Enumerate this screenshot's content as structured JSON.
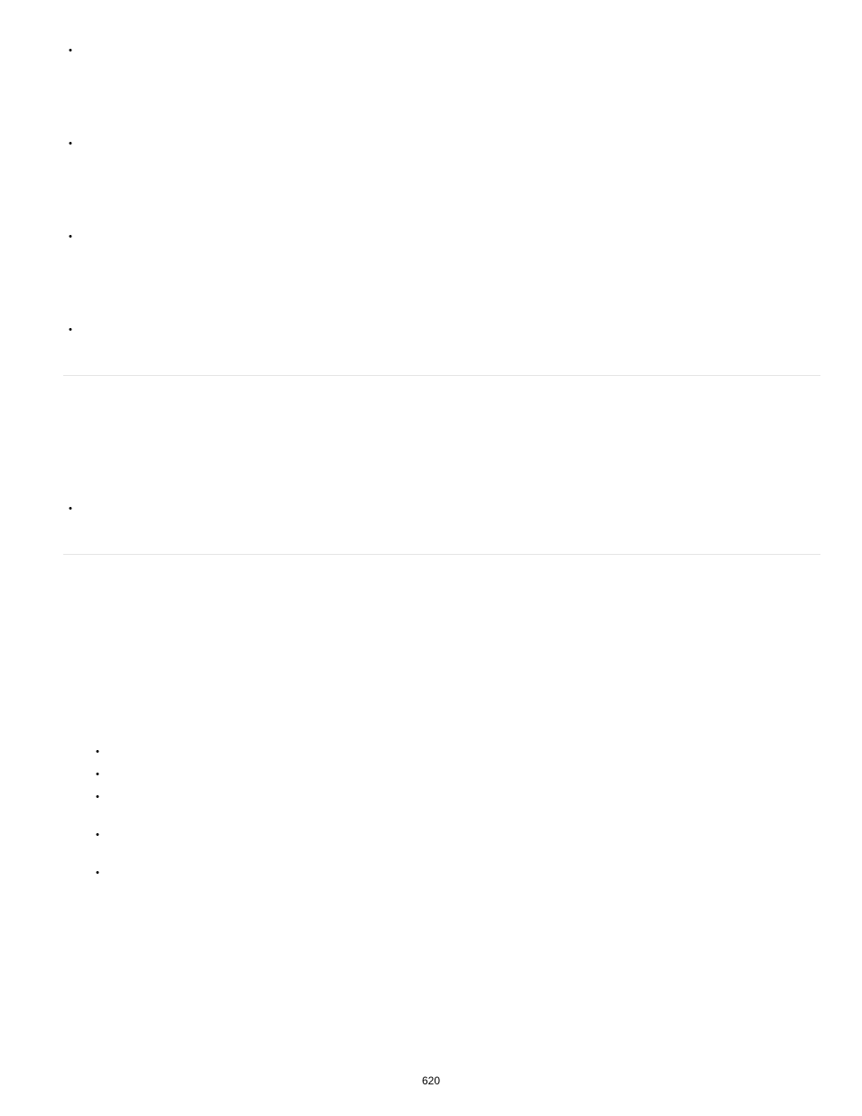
{
  "page_number": "620"
}
